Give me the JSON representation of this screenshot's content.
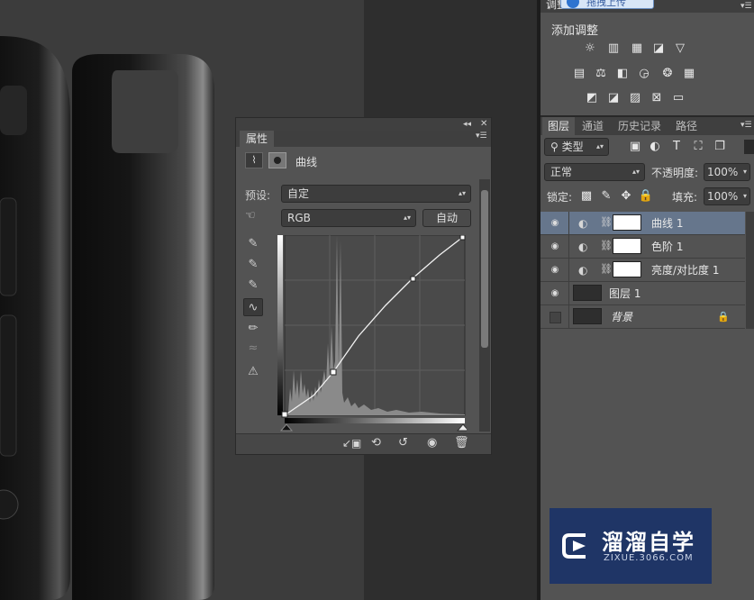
{
  "properties": {
    "title": "属性",
    "curves_label": "曲线",
    "preset_label": "预设:",
    "preset_value": "自定",
    "channel_value": "RGB",
    "auto_button": "自动"
  },
  "adjustments": {
    "tab_label": "调整",
    "upload_badge": "拖拽上传",
    "add_label": "添加调整"
  },
  "layers_panel": {
    "tabs": [
      "图层",
      "通道",
      "历史记录",
      "路径"
    ],
    "filter_kind": "类型",
    "blend_mode": "正常",
    "opacity_label": "不透明度:",
    "opacity_value": "100%",
    "lock_label": "锁定:",
    "fill_label": "填充:",
    "fill_value": "100%",
    "layers": [
      {
        "name": "曲线 1"
      },
      {
        "name": "色阶 1"
      },
      {
        "name": "亮度/对比度 1"
      },
      {
        "name": "图层 1"
      },
      {
        "name": "背景"
      }
    ]
  },
  "watermark": {
    "title": "溜溜自学",
    "url": "ZIXUE.3066.COM"
  },
  "colors": {
    "panel_bg": "#535353",
    "selected_row": "#66768c",
    "watermark_bg": "#1f3566"
  }
}
